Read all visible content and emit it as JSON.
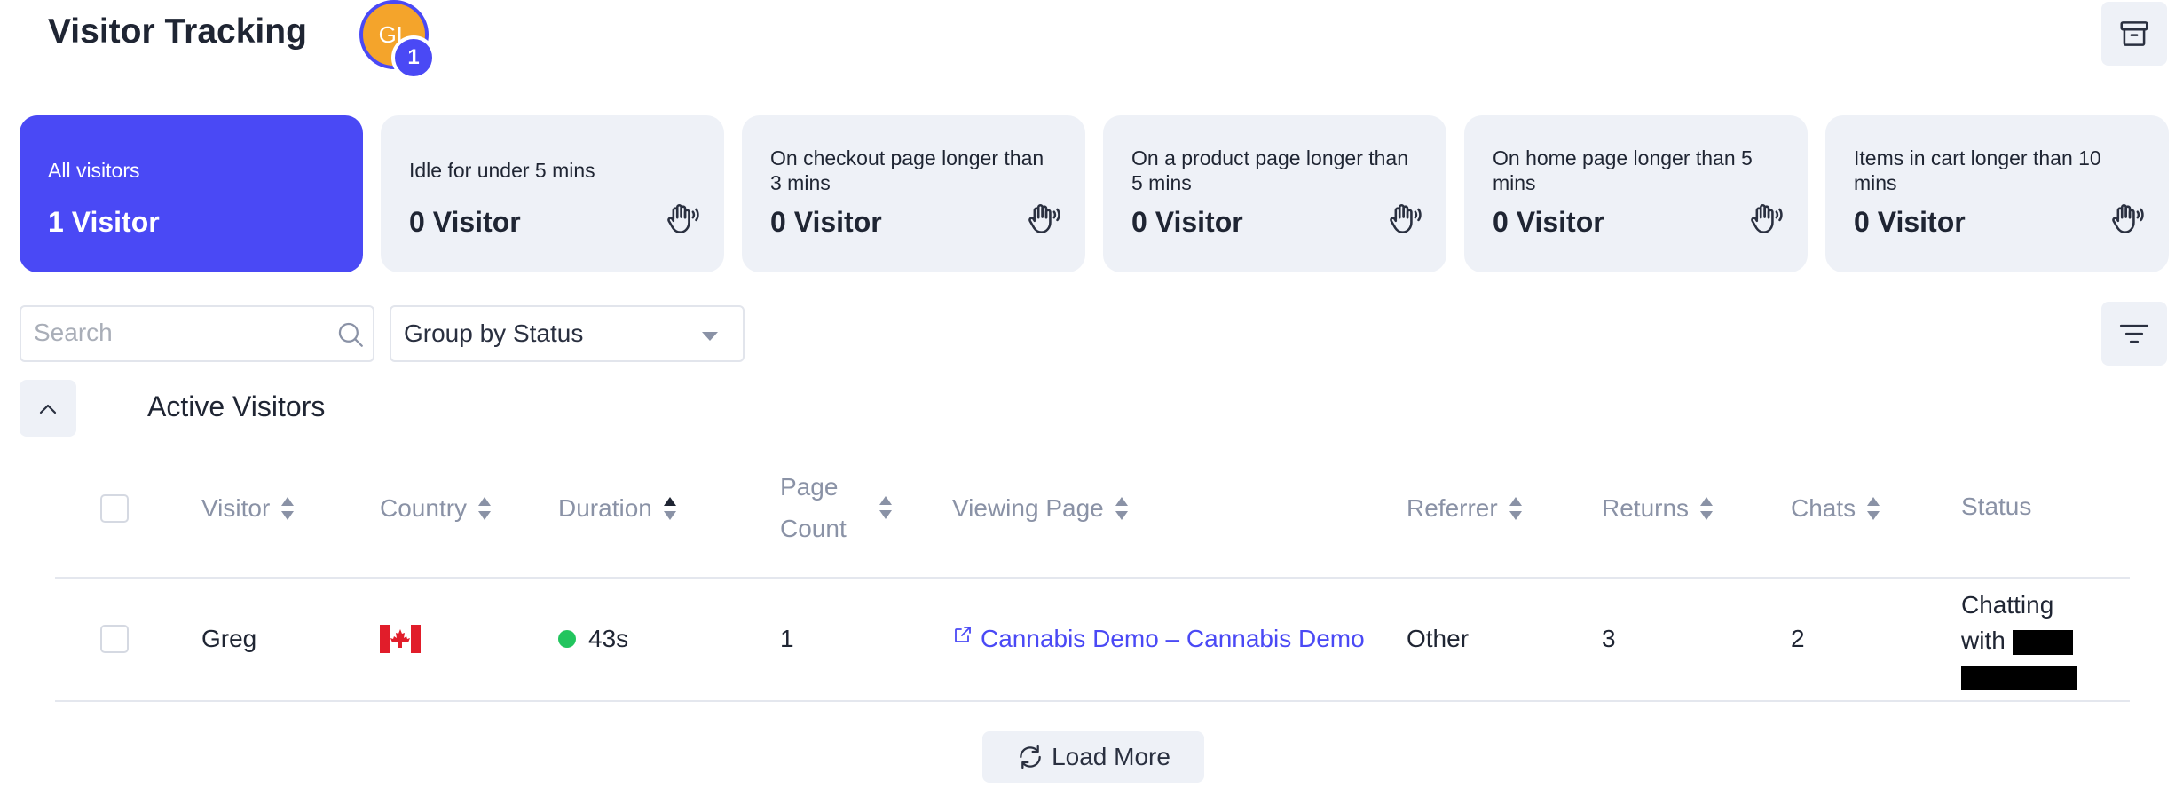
{
  "header": {
    "title": "Visitor Tracking",
    "avatar_initials": "GL",
    "avatar_badge": "1"
  },
  "cards": [
    {
      "label": "All visitors",
      "value": "1 Visitor",
      "active": true
    },
    {
      "label": "Idle for under 5 mins",
      "value": "0 Visitor",
      "icon": "wave-hand-icon"
    },
    {
      "label": "On checkout page longer than 3 mins",
      "value": "0 Visitor",
      "icon": "wave-hand-icon"
    },
    {
      "label": "On a product page longer than 5 mins",
      "value": "0 Visitor",
      "icon": "wave-hand-icon"
    },
    {
      "label": "On home page longer than 5 mins",
      "value": "0 Visitor",
      "icon": "wave-hand-icon"
    },
    {
      "label": "Items in cart longer than 10 mins",
      "value": "0 Visitor",
      "icon": "wave-hand-icon"
    }
  ],
  "search": {
    "placeholder": "Search",
    "value": ""
  },
  "group_select": {
    "selected": "Group by Status"
  },
  "section": {
    "title": "Active Visitors"
  },
  "table": {
    "columns": [
      "Visitor",
      "Country",
      "Duration",
      "Page Count",
      "Viewing Page",
      "Referrer",
      "Returns",
      "Chats",
      "Status"
    ],
    "rows": [
      {
        "visitor": "Greg",
        "country_flag": "canada-flag-icon",
        "duration": "43s",
        "page_count": "1",
        "viewing_page": "Cannabis Demo – Cannabis Demo",
        "referrer": "Other",
        "returns": "3",
        "chats": "2",
        "status_line1": "Chatting",
        "status_line2": "with"
      }
    ]
  },
  "load_more": {
    "label": "Load More"
  },
  "colors": {
    "accent": "#4a49f5",
    "card_bg": "#eef1f7",
    "online": "#22c55e",
    "avatar": "#f4a42b"
  }
}
